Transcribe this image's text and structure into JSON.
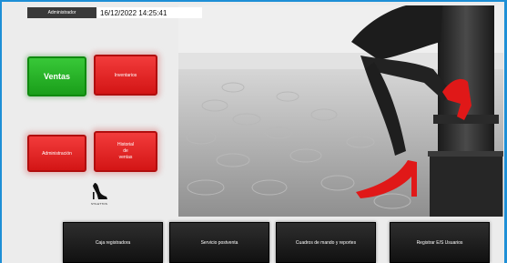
{
  "status": {
    "role": "Administrador",
    "datetime": "16/12/2022 14:25:41"
  },
  "tiles": {
    "ventas": "Ventas",
    "inventarios": "Inventarios",
    "administracion": "Administración",
    "historial_ventas": "Historial\nde\nventas"
  },
  "logo": {
    "name": "STILETTOS",
    "subtitle": "Dreams come true"
  },
  "nav": {
    "caja": "Caja registradora",
    "servicio": "Servicio postventa",
    "cuadros": "Cuadros de mando y reportes",
    "registrar": "Registrar E/S Usuarios"
  },
  "colors": {
    "accent_border": "#1e8fd6",
    "green_tile": "#1a9e1a",
    "red_tile": "#d31515",
    "nav_button": "#111111"
  }
}
